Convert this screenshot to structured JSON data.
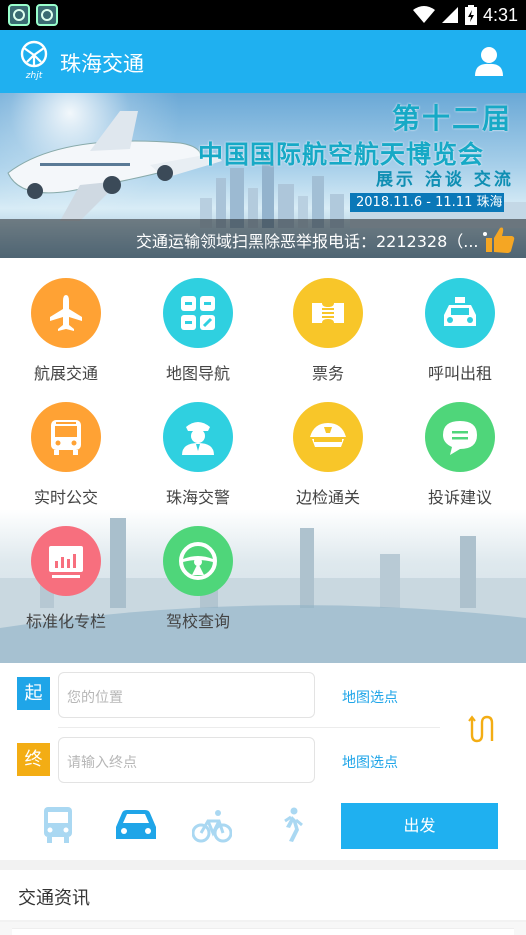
{
  "status_bar": {
    "time": "4:31"
  },
  "header": {
    "title": "珠海交通",
    "logo_text": "zhjt"
  },
  "banner": {
    "title_line1": "第十二届",
    "title_line2": "中国国际航空航天博览会",
    "tags": "展示 洽谈 交流",
    "date_place": "2018.11.6 - 11.11  珠海",
    "marquee": "交通运输领域扫黑除恶举报电话：2212328（..."
  },
  "menu": [
    {
      "label": "航展交通",
      "color": "#ffa234",
      "icon": "airplane-icon"
    },
    {
      "label": "地图导航",
      "color": "#2fd0e0",
      "icon": "map-grid-icon"
    },
    {
      "label": "票务",
      "color": "#f8c629",
      "icon": "ticket-icon"
    },
    {
      "label": "呼叫出租",
      "color": "#2fd0e0",
      "icon": "taxi-icon"
    },
    {
      "label": "实时公交",
      "color": "#ffa234",
      "icon": "bus-icon"
    },
    {
      "label": "珠海交警",
      "color": "#2fd0e0",
      "icon": "police-icon"
    },
    {
      "label": "边检通关",
      "color": "#f8c629",
      "icon": "officer-cap-icon"
    },
    {
      "label": "投诉建议",
      "color": "#4fd67a",
      "icon": "chat-icon"
    },
    {
      "label": "标准化专栏",
      "color": "#f76f7e",
      "icon": "chart-board-icon"
    },
    {
      "label": "驾校查询",
      "color": "#4fd67a",
      "icon": "steering-wheel-icon"
    }
  ],
  "route": {
    "start_tag": "起",
    "end_tag": "终",
    "start_placeholder": "您的位置",
    "end_placeholder": "请输入终点",
    "map_pick": "地图选点",
    "go_button": "出发",
    "modes": [
      "bus-icon",
      "car-icon",
      "bicycle-icon",
      "walk-icon"
    ],
    "selected_mode": "car-icon"
  },
  "news": {
    "title": "交通资讯"
  },
  "colors": {
    "primary": "#1fb0f0",
    "accent_orange": "#f3ad14"
  }
}
